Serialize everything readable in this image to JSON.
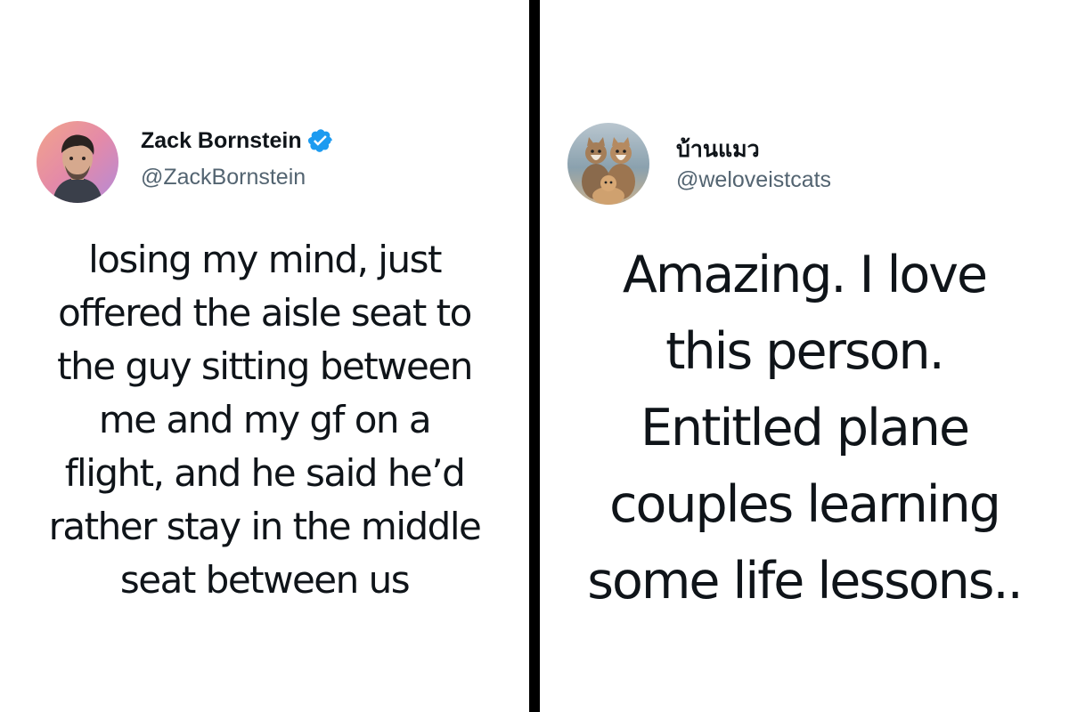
{
  "tweets": [
    {
      "user": {
        "display_name": "Zack Bornstein",
        "handle": "@ZackBornstein",
        "verified": true,
        "avatar_icon": "person-portrait-avatar"
      },
      "text": "losing my mind, just\noffered the aisle seat to\nthe guy sitting between\nme and my gf on a\nflight, and he said he’d\nrather stay in the middle\nseat between us"
    },
    {
      "user": {
        "display_name": "บ้านแมว",
        "handle": "@weloveistcats",
        "verified": false,
        "avatar_icon": "cats-photo-avatar"
      },
      "text": "Amazing. I love\nthis person.\nEntitled plane\ncouples learning\nsome life lessons.."
    }
  ],
  "colors": {
    "divider": "#000000",
    "text_primary": "#0f1419",
    "text_secondary": "#536471",
    "verified_badge": "#1d9bf0"
  }
}
